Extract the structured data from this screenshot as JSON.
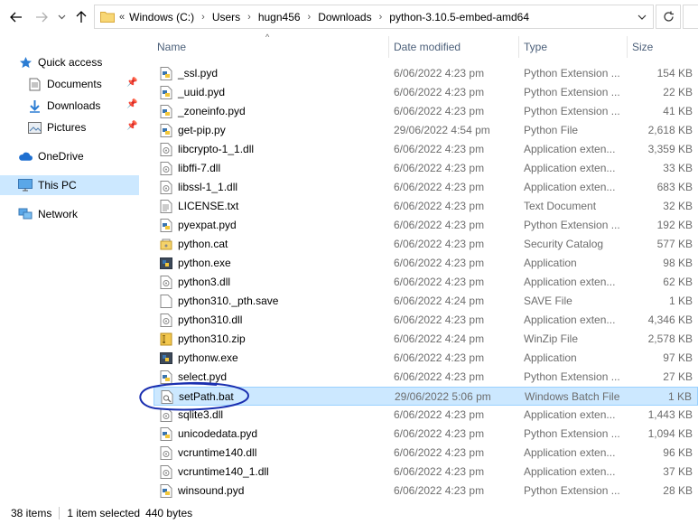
{
  "addressbar": {
    "overflow": "«",
    "crumbs": [
      "Windows (C:)",
      "Users",
      "hugn456",
      "Downloads",
      "python-3.10.5-embed-amd64"
    ]
  },
  "sidebar": {
    "items": [
      {
        "label": "Quick access",
        "icon": "star-icon"
      },
      {
        "label": "Documents",
        "icon": "documents-icon",
        "pinned": true
      },
      {
        "label": "Downloads",
        "icon": "download-arrow-icon",
        "pinned": true
      },
      {
        "label": "Pictures",
        "icon": "pictures-icon",
        "pinned": true
      },
      {
        "label": "OneDrive",
        "icon": "cloud-icon"
      },
      {
        "label": "This PC",
        "icon": "computer-icon",
        "selected": true
      },
      {
        "label": "Network",
        "icon": "network-icon"
      }
    ]
  },
  "columns": {
    "name": "Name",
    "date": "Date modified",
    "type": "Type",
    "size": "Size"
  },
  "files": [
    {
      "name": "_ssl.pyd",
      "date": "6/06/2022 4:23 pm",
      "type": "Python Extension ...",
      "size": "154 KB",
      "icon": "python-file-icon"
    },
    {
      "name": "_uuid.pyd",
      "date": "6/06/2022 4:23 pm",
      "type": "Python Extension ...",
      "size": "22 KB",
      "icon": "python-file-icon"
    },
    {
      "name": "_zoneinfo.pyd",
      "date": "6/06/2022 4:23 pm",
      "type": "Python Extension ...",
      "size": "41 KB",
      "icon": "python-file-icon"
    },
    {
      "name": "get-pip.py",
      "date": "29/06/2022 4:54 pm",
      "type": "Python File",
      "size": "2,618 KB",
      "icon": "python-file-icon"
    },
    {
      "name": "libcrypto-1_1.dll",
      "date": "6/06/2022 4:23 pm",
      "type": "Application exten...",
      "size": "3,359 KB",
      "icon": "dll-file-icon"
    },
    {
      "name": "libffi-7.dll",
      "date": "6/06/2022 4:23 pm",
      "type": "Application exten...",
      "size": "33 KB",
      "icon": "dll-file-icon"
    },
    {
      "name": "libssl-1_1.dll",
      "date": "6/06/2022 4:23 pm",
      "type": "Application exten...",
      "size": "683 KB",
      "icon": "dll-file-icon"
    },
    {
      "name": "LICENSE.txt",
      "date": "6/06/2022 4:23 pm",
      "type": "Text Document",
      "size": "32 KB",
      "icon": "text-file-icon"
    },
    {
      "name": "pyexpat.pyd",
      "date": "6/06/2022 4:23 pm",
      "type": "Python Extension ...",
      "size": "192 KB",
      "icon": "python-file-icon"
    },
    {
      "name": "python.cat",
      "date": "6/06/2022 4:23 pm",
      "type": "Security Catalog",
      "size": "577 KB",
      "icon": "catalog-file-icon"
    },
    {
      "name": "python.exe",
      "date": "6/06/2022 4:23 pm",
      "type": "Application",
      "size": "98 KB",
      "icon": "python-exe-icon"
    },
    {
      "name": "python3.dll",
      "date": "6/06/2022 4:23 pm",
      "type": "Application exten...",
      "size": "62 KB",
      "icon": "dll-file-icon"
    },
    {
      "name": "python310._pth.save",
      "date": "6/06/2022 4:24 pm",
      "type": "SAVE File",
      "size": "1 KB",
      "icon": "blank-file-icon"
    },
    {
      "name": "python310.dll",
      "date": "6/06/2022 4:23 pm",
      "type": "Application exten...",
      "size": "4,346 KB",
      "icon": "dll-file-icon"
    },
    {
      "name": "python310.zip",
      "date": "6/06/2022 4:24 pm",
      "type": "WinZip File",
      "size": "2,578 KB",
      "icon": "zip-file-icon"
    },
    {
      "name": "pythonw.exe",
      "date": "6/06/2022 4:23 pm",
      "type": "Application",
      "size": "97 KB",
      "icon": "python-exe-icon"
    },
    {
      "name": "select.pyd",
      "date": "6/06/2022 4:23 pm",
      "type": "Python Extension ...",
      "size": "27 KB",
      "icon": "python-file-icon"
    },
    {
      "name": "setPath.bat",
      "date": "29/06/2022 5:06 pm",
      "type": "Windows Batch File",
      "size": "1 KB",
      "icon": "batch-file-icon",
      "selected": true
    },
    {
      "name": "sqlite3.dll",
      "date": "6/06/2022 4:23 pm",
      "type": "Application exten...",
      "size": "1,443 KB",
      "icon": "dll-file-icon"
    },
    {
      "name": "unicodedata.pyd",
      "date": "6/06/2022 4:23 pm",
      "type": "Python Extension ...",
      "size": "1,094 KB",
      "icon": "python-file-icon"
    },
    {
      "name": "vcruntime140.dll",
      "date": "6/06/2022 4:23 pm",
      "type": "Application exten...",
      "size": "96 KB",
      "icon": "dll-file-icon"
    },
    {
      "name": "vcruntime140_1.dll",
      "date": "6/06/2022 4:23 pm",
      "type": "Application exten...",
      "size": "37 KB",
      "icon": "dll-file-icon"
    },
    {
      "name": "winsound.pyd",
      "date": "6/06/2022 4:23 pm",
      "type": "Python Extension ...",
      "size": "28 KB",
      "icon": "python-file-icon"
    }
  ],
  "statusbar": {
    "item_count": "38 items",
    "selection": "1 item selected",
    "selection_size": "440 bytes"
  },
  "colors": {
    "selection_bg": "#cce8ff",
    "selection_border": "#99d1ff",
    "header_text": "#4c607a",
    "annotation": "#1a2fb0"
  }
}
